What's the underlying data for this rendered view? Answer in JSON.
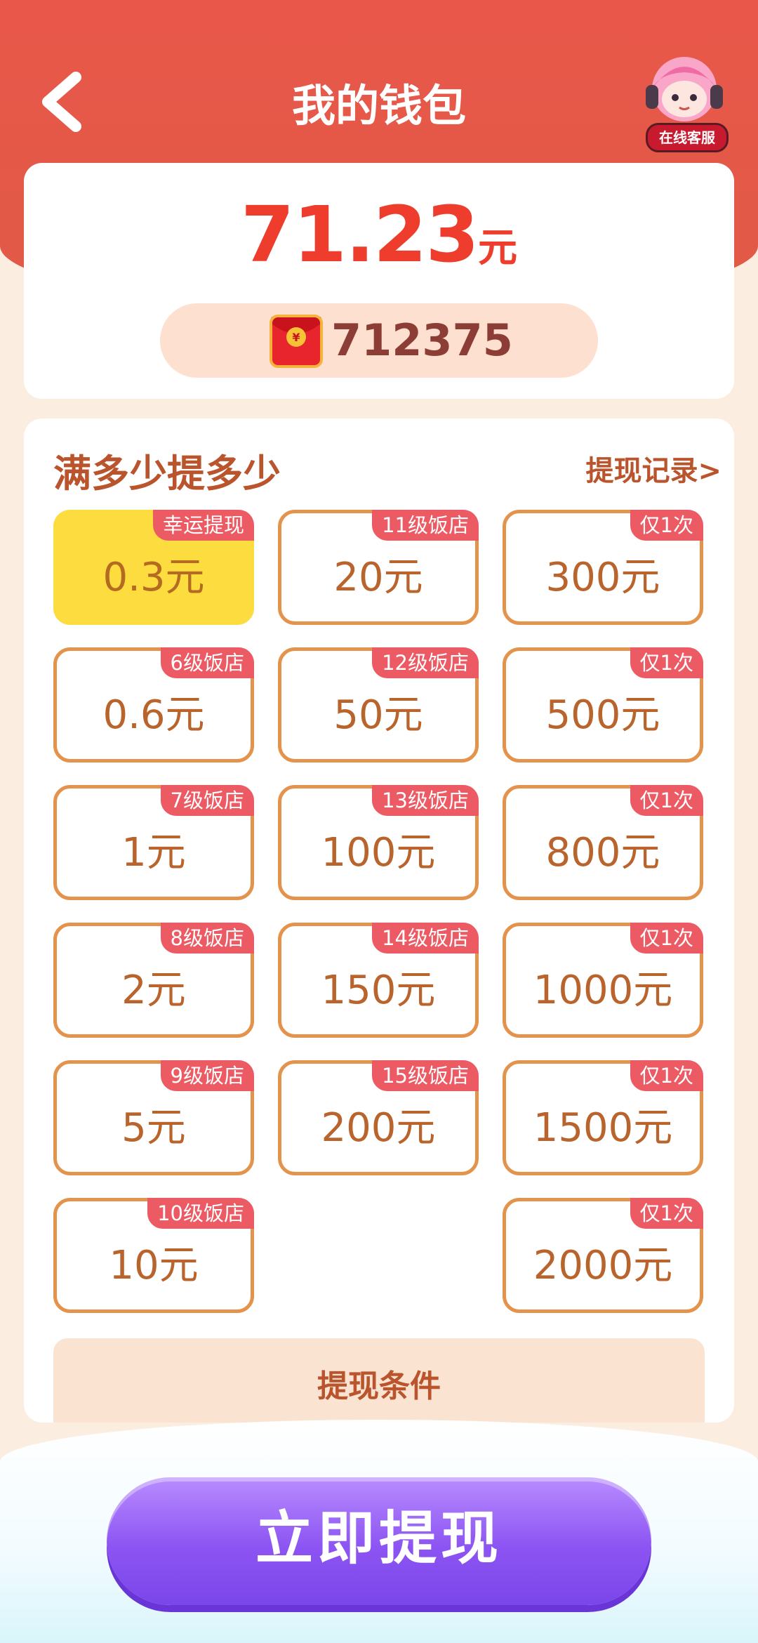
{
  "header": {
    "title": "我的钱包",
    "service_label": "在线客服"
  },
  "balance": {
    "amount": "71.23",
    "unit": "元",
    "coins": "712375"
  },
  "panel": {
    "title": "满多少提多少",
    "record_link": "提现记录",
    "record_chevron": ">",
    "tiles": [
      {
        "amount": "0.3元",
        "tag": "幸运提现",
        "selected": true
      },
      {
        "amount": "20元",
        "tag": "11级饭店"
      },
      {
        "amount": "300元",
        "tag": "仅1次"
      },
      {
        "amount": "0.6元",
        "tag": "6级饭店"
      },
      {
        "amount": "50元",
        "tag": "12级饭店"
      },
      {
        "amount": "500元",
        "tag": "仅1次"
      },
      {
        "amount": "1元",
        "tag": "7级饭店"
      },
      {
        "amount": "100元",
        "tag": "13级饭店"
      },
      {
        "amount": "800元",
        "tag": "仅1次"
      },
      {
        "amount": "2元",
        "tag": "8级饭店"
      },
      {
        "amount": "150元",
        "tag": "14级饭店"
      },
      {
        "amount": "1000元",
        "tag": "仅1次"
      },
      {
        "amount": "5元",
        "tag": "9级饭店"
      },
      {
        "amount": "200元",
        "tag": "15级饭店"
      },
      {
        "amount": "1500元",
        "tag": "仅1次"
      },
      {
        "amount": "10元",
        "tag": "10级饭店"
      },
      {
        "amount": "2000元",
        "tag": "仅1次"
      }
    ],
    "conditions_title": "提现条件"
  },
  "footer": {
    "withdraw_button": "立即提现"
  },
  "colors": {
    "accent_red": "#e9574a",
    "tile_border": "#e4934c",
    "tag_bg": "#ec5a64",
    "selected_bg": "#fcdc3e",
    "button_purple": "#8c54f2"
  }
}
